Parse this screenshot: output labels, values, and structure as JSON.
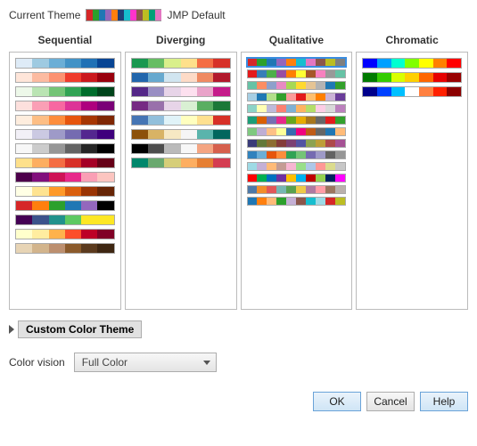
{
  "header": {
    "label": "Current Theme",
    "value": "JMP Default",
    "swatch": [
      "#d62728",
      "#2ca02c",
      "#1f77b4",
      "#9467bd",
      "#ff7f0e",
      "#1f3f77",
      "#17becf",
      "#ff33cc",
      "#8c564b",
      "#bcbd22",
      "#00a079",
      "#e377c2"
    ]
  },
  "columns": [
    {
      "title": "Sequential"
    },
    {
      "title": "Diverging"
    },
    {
      "title": "Qualitative"
    },
    {
      "title": "Chromatic"
    }
  ],
  "custom": {
    "label": "Custom Color Theme"
  },
  "vision": {
    "label": "Color vision",
    "value": "Full Color"
  },
  "buttons": {
    "ok": "OK",
    "cancel": "Cancel",
    "help": "Help"
  },
  "palettes": {
    "sequential": [
      [
        "#deebf7",
        "#9ecae1",
        "#6baed6",
        "#4292c6",
        "#2171b5",
        "#084594"
      ],
      [
        "#fee5d9",
        "#fcbba1",
        "#fc9272",
        "#ef3b2c",
        "#cb181d",
        "#99000d"
      ],
      [
        "#edf8e9",
        "#bae4b3",
        "#74c476",
        "#31a354",
        "#006d2c",
        "#00441b"
      ],
      [
        "#fde0dd",
        "#fa9fb5",
        "#f768a1",
        "#dd3497",
        "#ae017e",
        "#7a0177"
      ],
      [
        "#feedde",
        "#fdbe85",
        "#fd8d3c",
        "#e6550d",
        "#a63603",
        "#7f2704"
      ],
      [
        "#f2f0f7",
        "#cbc9e2",
        "#9e9ac8",
        "#756bb1",
        "#54278f",
        "#3f007d"
      ],
      [
        "#f7f7f7",
        "#cccccc",
        "#969696",
        "#636363",
        "#252525",
        "#000000"
      ],
      [
        "#fee08b",
        "#fdae61",
        "#f46d43",
        "#d73027",
        "#a50026",
        "#660017"
      ],
      [
        "#4d004b",
        "#810f7c",
        "#ce1256",
        "#e7298a",
        "#fa9fb5",
        "#fcc5c0"
      ],
      [
        "#ffffe5",
        "#fee391",
        "#fe9929",
        "#d95f0e",
        "#993404",
        "#662506"
      ],
      [
        "#d62728",
        "#ff7f0e",
        "#2ca02c",
        "#1f77b4",
        "#9467bd",
        "#000000"
      ],
      [
        "#440154",
        "#3b528b",
        "#21918c",
        "#5ec962",
        "#fde725",
        "#fde725"
      ],
      [
        "#ffffcc",
        "#ffeda0",
        "#feb24c",
        "#fc4e2a",
        "#bd0026",
        "#800026"
      ],
      [
        "#e7d4b5",
        "#d2b48c",
        "#bc8f6f",
        "#8b5a2b",
        "#5b3a1e",
        "#3e2612"
      ]
    ],
    "diverging": [
      [
        "#1a9850",
        "#66bd63",
        "#d9ef8b",
        "#fee08b",
        "#f46d43",
        "#d73027"
      ],
      [
        "#2166ac",
        "#67a9cf",
        "#d1e5f0",
        "#fddbc7",
        "#ef8a62",
        "#b2182b"
      ],
      [
        "#542788",
        "#998ec3",
        "#e7d4e8",
        "#fde0ef",
        "#e9a3c9",
        "#c51b8a"
      ],
      [
        "#762a83",
        "#9970ab",
        "#e7d4e8",
        "#d9f0d3",
        "#5aae61",
        "#1b7837"
      ],
      [
        "#4575b4",
        "#91bfdb",
        "#e0f3f8",
        "#ffffbf",
        "#fee090",
        "#d73027"
      ],
      [
        "#8c510a",
        "#d8b365",
        "#f6e8c3",
        "#f5f5f5",
        "#5ab4ac",
        "#01665e"
      ],
      [
        "#000000",
        "#4d4d4d",
        "#bababa",
        "#f7f7f7",
        "#f4a582",
        "#d6604d"
      ],
      [
        "#00876c",
        "#6aa96f",
        "#d6ce79",
        "#fdae61",
        "#e67f33",
        "#d43d51"
      ]
    ],
    "qualitative": [
      [
        "#d62728",
        "#2ca02c",
        "#1f77b4",
        "#9467bd",
        "#ff7f0e",
        "#17becf",
        "#e377c2",
        "#8c564b",
        "#bcbd22",
        "#7f7f7f"
      ],
      [
        "#e41a1c",
        "#377eb8",
        "#4daf4a",
        "#984ea3",
        "#ff7f00",
        "#ffff33",
        "#a65628",
        "#f781bf",
        "#999999",
        "#66c2a5"
      ],
      [
        "#66c2a5",
        "#fc8d62",
        "#8da0cb",
        "#e78ac3",
        "#a6d854",
        "#ffd92f",
        "#e5c494",
        "#b3b3b3",
        "#1f78b4",
        "#33a02c"
      ],
      [
        "#a6cee3",
        "#1f78b4",
        "#b2df8a",
        "#33a02c",
        "#fb9a99",
        "#e31a1c",
        "#fdbf6f",
        "#ff7f00",
        "#cab2d6",
        "#6a3d9a"
      ],
      [
        "#8dd3c7",
        "#ffffb3",
        "#bebada",
        "#fb8072",
        "#80b1d3",
        "#fdb462",
        "#b3de69",
        "#fccde5",
        "#d9d9d9",
        "#bc80bd"
      ],
      [
        "#1b9e77",
        "#d95f02",
        "#7570b3",
        "#e7298a",
        "#66a61e",
        "#e6ab02",
        "#a6761d",
        "#666666",
        "#e31a1c",
        "#33a02c"
      ],
      [
        "#7fc97f",
        "#beaed4",
        "#fdc086",
        "#ffff99",
        "#386cb0",
        "#f0027f",
        "#bf5b17",
        "#666666",
        "#1f77b4",
        "#ffbb78"
      ],
      [
        "#393b79",
        "#637939",
        "#8c6d31",
        "#843c39",
        "#7b4173",
        "#5254a3",
        "#8ca252",
        "#bd9e39",
        "#ad494a",
        "#a55194"
      ],
      [
        "#3182bd",
        "#6baed6",
        "#e6550d",
        "#fd8d3c",
        "#31a354",
        "#74c476",
        "#756bb1",
        "#9e9ac8",
        "#636363",
        "#969696"
      ],
      [
        "#9edae5",
        "#c5b0d5",
        "#ffbb78",
        "#c49c94",
        "#f7b6d2",
        "#98df8a",
        "#aec7e8",
        "#ff9896",
        "#dbdb8d",
        "#c7c7c7"
      ],
      [
        "#ff0000",
        "#00b050",
        "#0070c0",
        "#7030a0",
        "#ffc000",
        "#00b0f0",
        "#c00000",
        "#92d050",
        "#002060",
        "#ff00ff"
      ],
      [
        "#4e79a7",
        "#f28e2b",
        "#e15759",
        "#76b7b2",
        "#59a14f",
        "#edc948",
        "#b07aa1",
        "#ff9da7",
        "#9c755f",
        "#bab0ac"
      ],
      [
        "#1f77b4",
        "#ff7f0e",
        "#ffbb78",
        "#2ca02c",
        "#c5b0d5",
        "#8c564b",
        "#17becf",
        "#9edae5",
        "#d62728",
        "#bcbd22"
      ]
    ],
    "chromatic": [
      [
        "#0000ff",
        "#00a0ff",
        "#00ffd0",
        "#80ff00",
        "#ffff00",
        "#ff8000",
        "#ff0000"
      ],
      [
        "#007a00",
        "#33cc00",
        "#d9ff00",
        "#ffd000",
        "#ff6600",
        "#e60000",
        "#990000"
      ],
      [
        "#00008b",
        "#0040ff",
        "#00c0ff",
        "#ffffff",
        "#ff8040",
        "#ff2000",
        "#8b0000"
      ]
    ]
  }
}
